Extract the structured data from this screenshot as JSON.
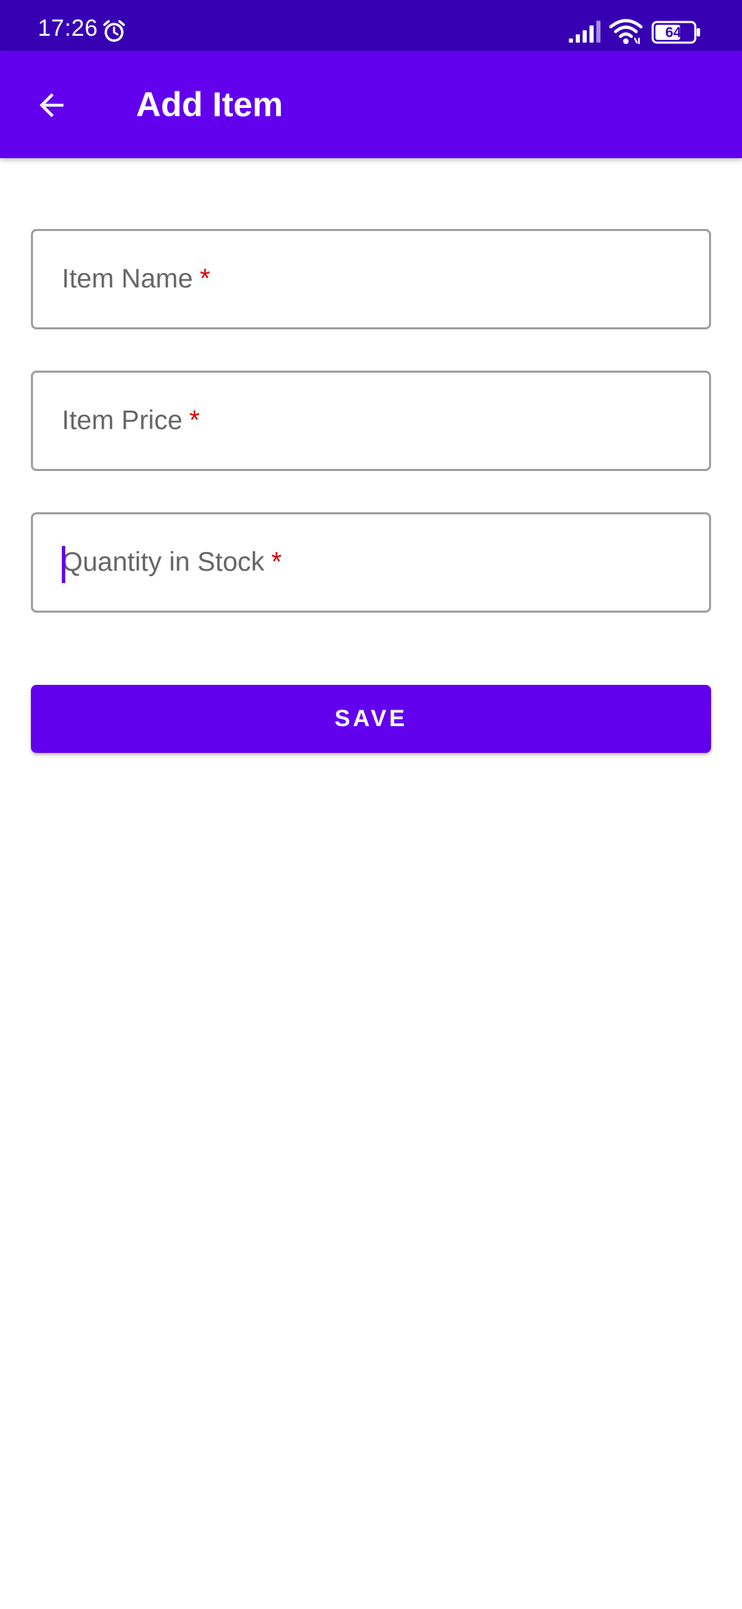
{
  "status_bar": {
    "time": "17:26",
    "battery_level": "64",
    "icons": [
      "alarm-icon",
      "signal-icon",
      "wifi-icon",
      "battery-icon"
    ],
    "background_color": "#3700b3"
  },
  "app_bar": {
    "title": "Add Item",
    "back_icon": "arrow-back-icon",
    "background_color": "#6200ee"
  },
  "form": {
    "fields": [
      {
        "label": "Item Name",
        "required_mark": "*",
        "value": ""
      },
      {
        "label": "Item Price",
        "required_mark": "*",
        "value": ""
      },
      {
        "label": "Quantity in Stock",
        "required_mark": "*",
        "value": "",
        "focused": true
      }
    ],
    "required_color": "#d50000",
    "save_label": "SAVE",
    "accent_color": "#6200ee"
  }
}
